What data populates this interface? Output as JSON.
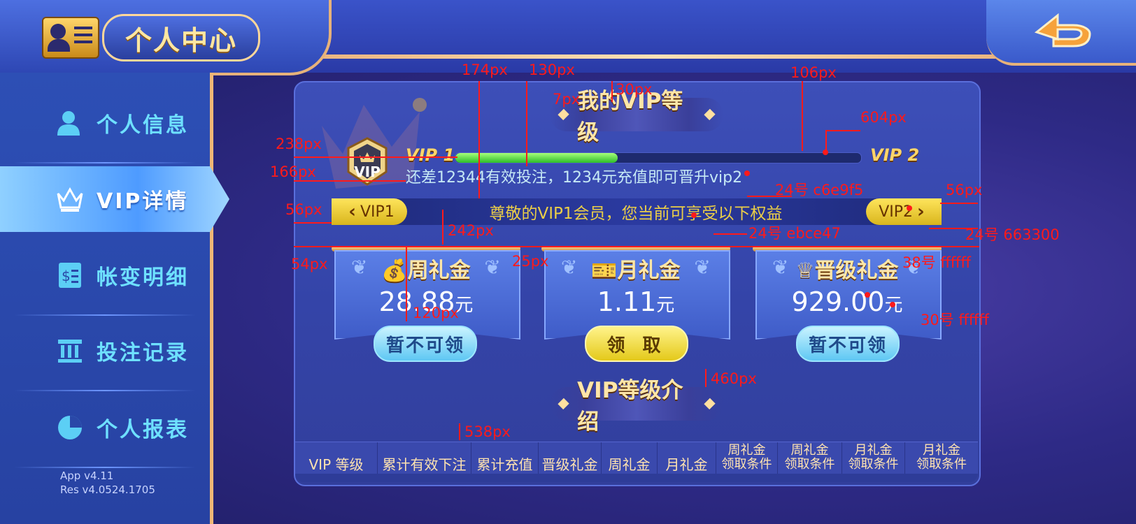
{
  "header": {
    "title": "个人中心",
    "back_icon": "back-arrow-icon",
    "avatar_icon": "profile-card-icon"
  },
  "sidebar": {
    "items": [
      {
        "label": "个人信息",
        "icon": "person-icon",
        "active": false
      },
      {
        "label": "VIP详情",
        "icon": "crown-icon",
        "active": true
      },
      {
        "label": "帐变明细",
        "icon": "ledger-icon",
        "active": false
      },
      {
        "label": "投注记录",
        "icon": "bank-icon",
        "active": false
      },
      {
        "label": "个人报表",
        "icon": "pie-chart-icon",
        "active": false
      }
    ],
    "version_app": "App v4.11",
    "version_res": "Res v4.0524.1705"
  },
  "vip": {
    "section_title": "我的VIP等级",
    "badge_text": "VIP",
    "current_level": "VIP 1",
    "next_level": "VIP 2",
    "progress_fraction": 0.4,
    "progress_note": "还差12344有效投注，1234元充值即可晋升vip2",
    "banner_text": "尊敬的VIP1会员，您当前可享受以下权益",
    "prev_pill": "VIP1",
    "next_pill": "VIP2"
  },
  "cards": [
    {
      "title": "周礼金",
      "amount": "28.88",
      "unit": "元",
      "button": "暂不可领",
      "button_state": "disabled",
      "icon": "money-bag-icon"
    },
    {
      "title": "月礼金",
      "amount": "1.11",
      "unit": "元",
      "button": "领 取",
      "button_state": "claim",
      "icon": "ticket-icon"
    },
    {
      "title": "晋级礼金",
      "amount": "929.00",
      "unit": "元",
      "button": "暂不可领",
      "button_state": "disabled",
      "icon": "crown-icon"
    }
  ],
  "intro": {
    "section_title": "VIP等级介绍",
    "columns": [
      [
        "VIP 等级"
      ],
      [
        "累计有效下注"
      ],
      [
        "累计充值"
      ],
      [
        "晋级礼金"
      ],
      [
        "周礼金"
      ],
      [
        "月礼金"
      ],
      [
        "周礼金",
        "领取条件"
      ],
      [
        "周礼金",
        "领取条件"
      ],
      [
        "月礼金",
        "领取条件"
      ],
      [
        "月礼金",
        "领取条件"
      ]
    ]
  },
  "annotations": {
    "a174": "174px",
    "a130": "130px",
    "a106": "106px",
    "a7": "7px",
    "a30": "30px",
    "a238": "238px",
    "a604": "604px",
    "a166": "166px",
    "a_c6e9f5": "24号 c6e9f5",
    "a56l": "56px",
    "a56r": "56px",
    "a242": "242px",
    "a_ebce47": "24号 ebce47",
    "a_663300": "24号 663300",
    "a54": "54px",
    "a25": "25px",
    "a_38": "38号 ffffff",
    "a120": "120px",
    "a_30": "30号 ffffff",
    "a460": "460px",
    "a538": "538px"
  },
  "colors": {
    "note": "#c6e9f5",
    "banner": "#ebce47",
    "pill": "#663300",
    "amount": "#ffffff",
    "annotation": "#ff1a1a",
    "accent_gold": "#f0b776"
  }
}
